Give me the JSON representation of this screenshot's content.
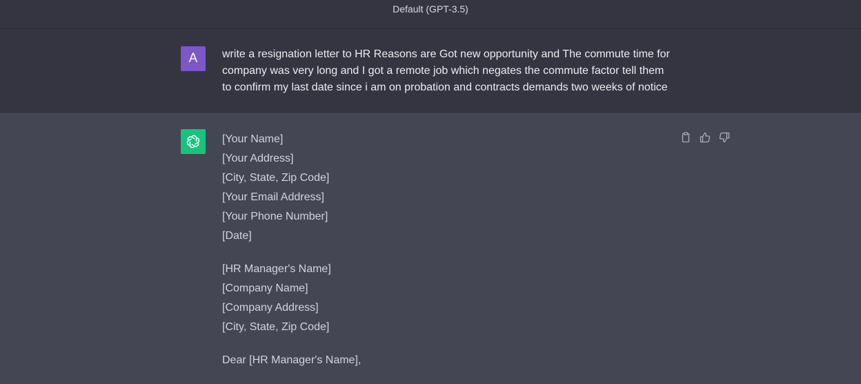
{
  "header": {
    "model_label": "Default (GPT-3.5)"
  },
  "user_message": {
    "avatar_letter": "A",
    "lines": [
      "write a resignation letter to HR Reasons are Got new opportunity and The commute time for",
      "company was very long and I got a remote job which negates the commute factor  tell them",
      "to confirm my last date since i am on probation and contracts demands two weeks of notice"
    ]
  },
  "assistant_message": {
    "sender_block": [
      "[Your Name]",
      "[Your Address]",
      "[City, State, Zip Code]",
      "[Your Email Address]",
      "[Your Phone Number]",
      "[Date]"
    ],
    "recipient_block": [
      "[HR Manager's Name]",
      "[Company Name]",
      "[Company Address]",
      "[City, State, Zip Code]"
    ],
    "salutation": "Dear [HR Manager's Name],"
  },
  "icons": [
    "copy-icon",
    "thumbs-up-icon",
    "thumbs-down-icon",
    "openai-logo-icon"
  ],
  "colors": {
    "user_bg": "#343541",
    "assistant_bg": "#444654",
    "user_avatar": "#7b57c7",
    "gpt_avatar": "#19c37d"
  }
}
